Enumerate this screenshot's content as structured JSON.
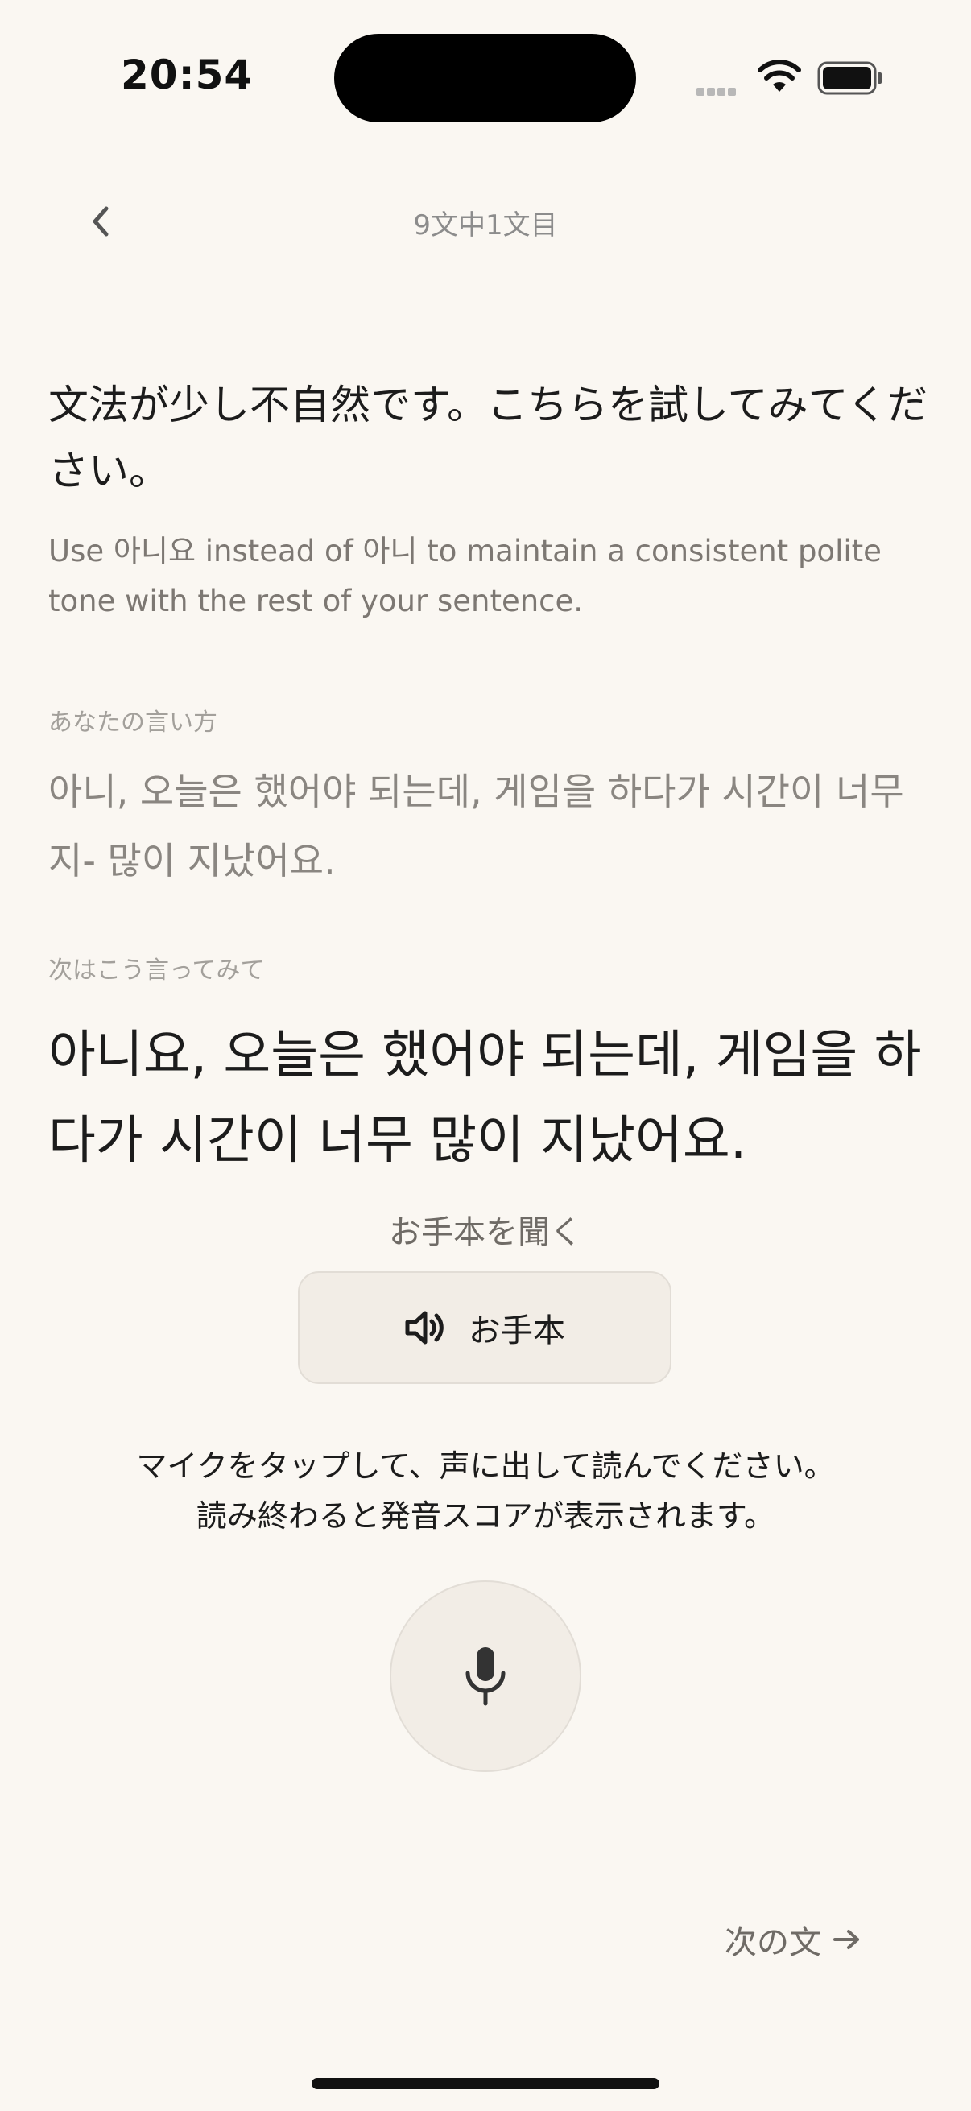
{
  "status_bar": {
    "time": "20:54"
  },
  "header": {
    "back_icon": "chevron-left-icon",
    "progress_title": "9文中1文目"
  },
  "feedback": {
    "title": "文法が少し不自然です。こちらを試してみてください。",
    "detail": "Use 아니요 instead of 아니 to maintain a consistent polite tone with the rest of your sentence."
  },
  "your_version": {
    "label": "あなたの言い方",
    "sentence": "아니, 오늘은 했어야 되는데, 게임을 하다가 시간이 너무 지- 많이 지났어요."
  },
  "suggestion": {
    "label": "次はこう言ってみて",
    "sentence": "아니요, 오늘은 했어야 되는데, 게임을 하다가 시간이 너무 많이 지났어요."
  },
  "listen": {
    "label": "お手本を聞く",
    "button_label": "お手本",
    "button_icon": "speaker-icon"
  },
  "recording": {
    "instructions": "マイクをタップして、声に出して読んでください。読み終わると発音スコアが表示されます。",
    "mic_icon": "microphone-icon"
  },
  "footer": {
    "next_label": "次の文",
    "next_icon": "arrow-right-icon"
  },
  "colors": {
    "background": "#faf7f2",
    "button_bg": "#f2ede6",
    "text_primary": "#1c1c1c",
    "text_secondary": "#7d7873"
  }
}
